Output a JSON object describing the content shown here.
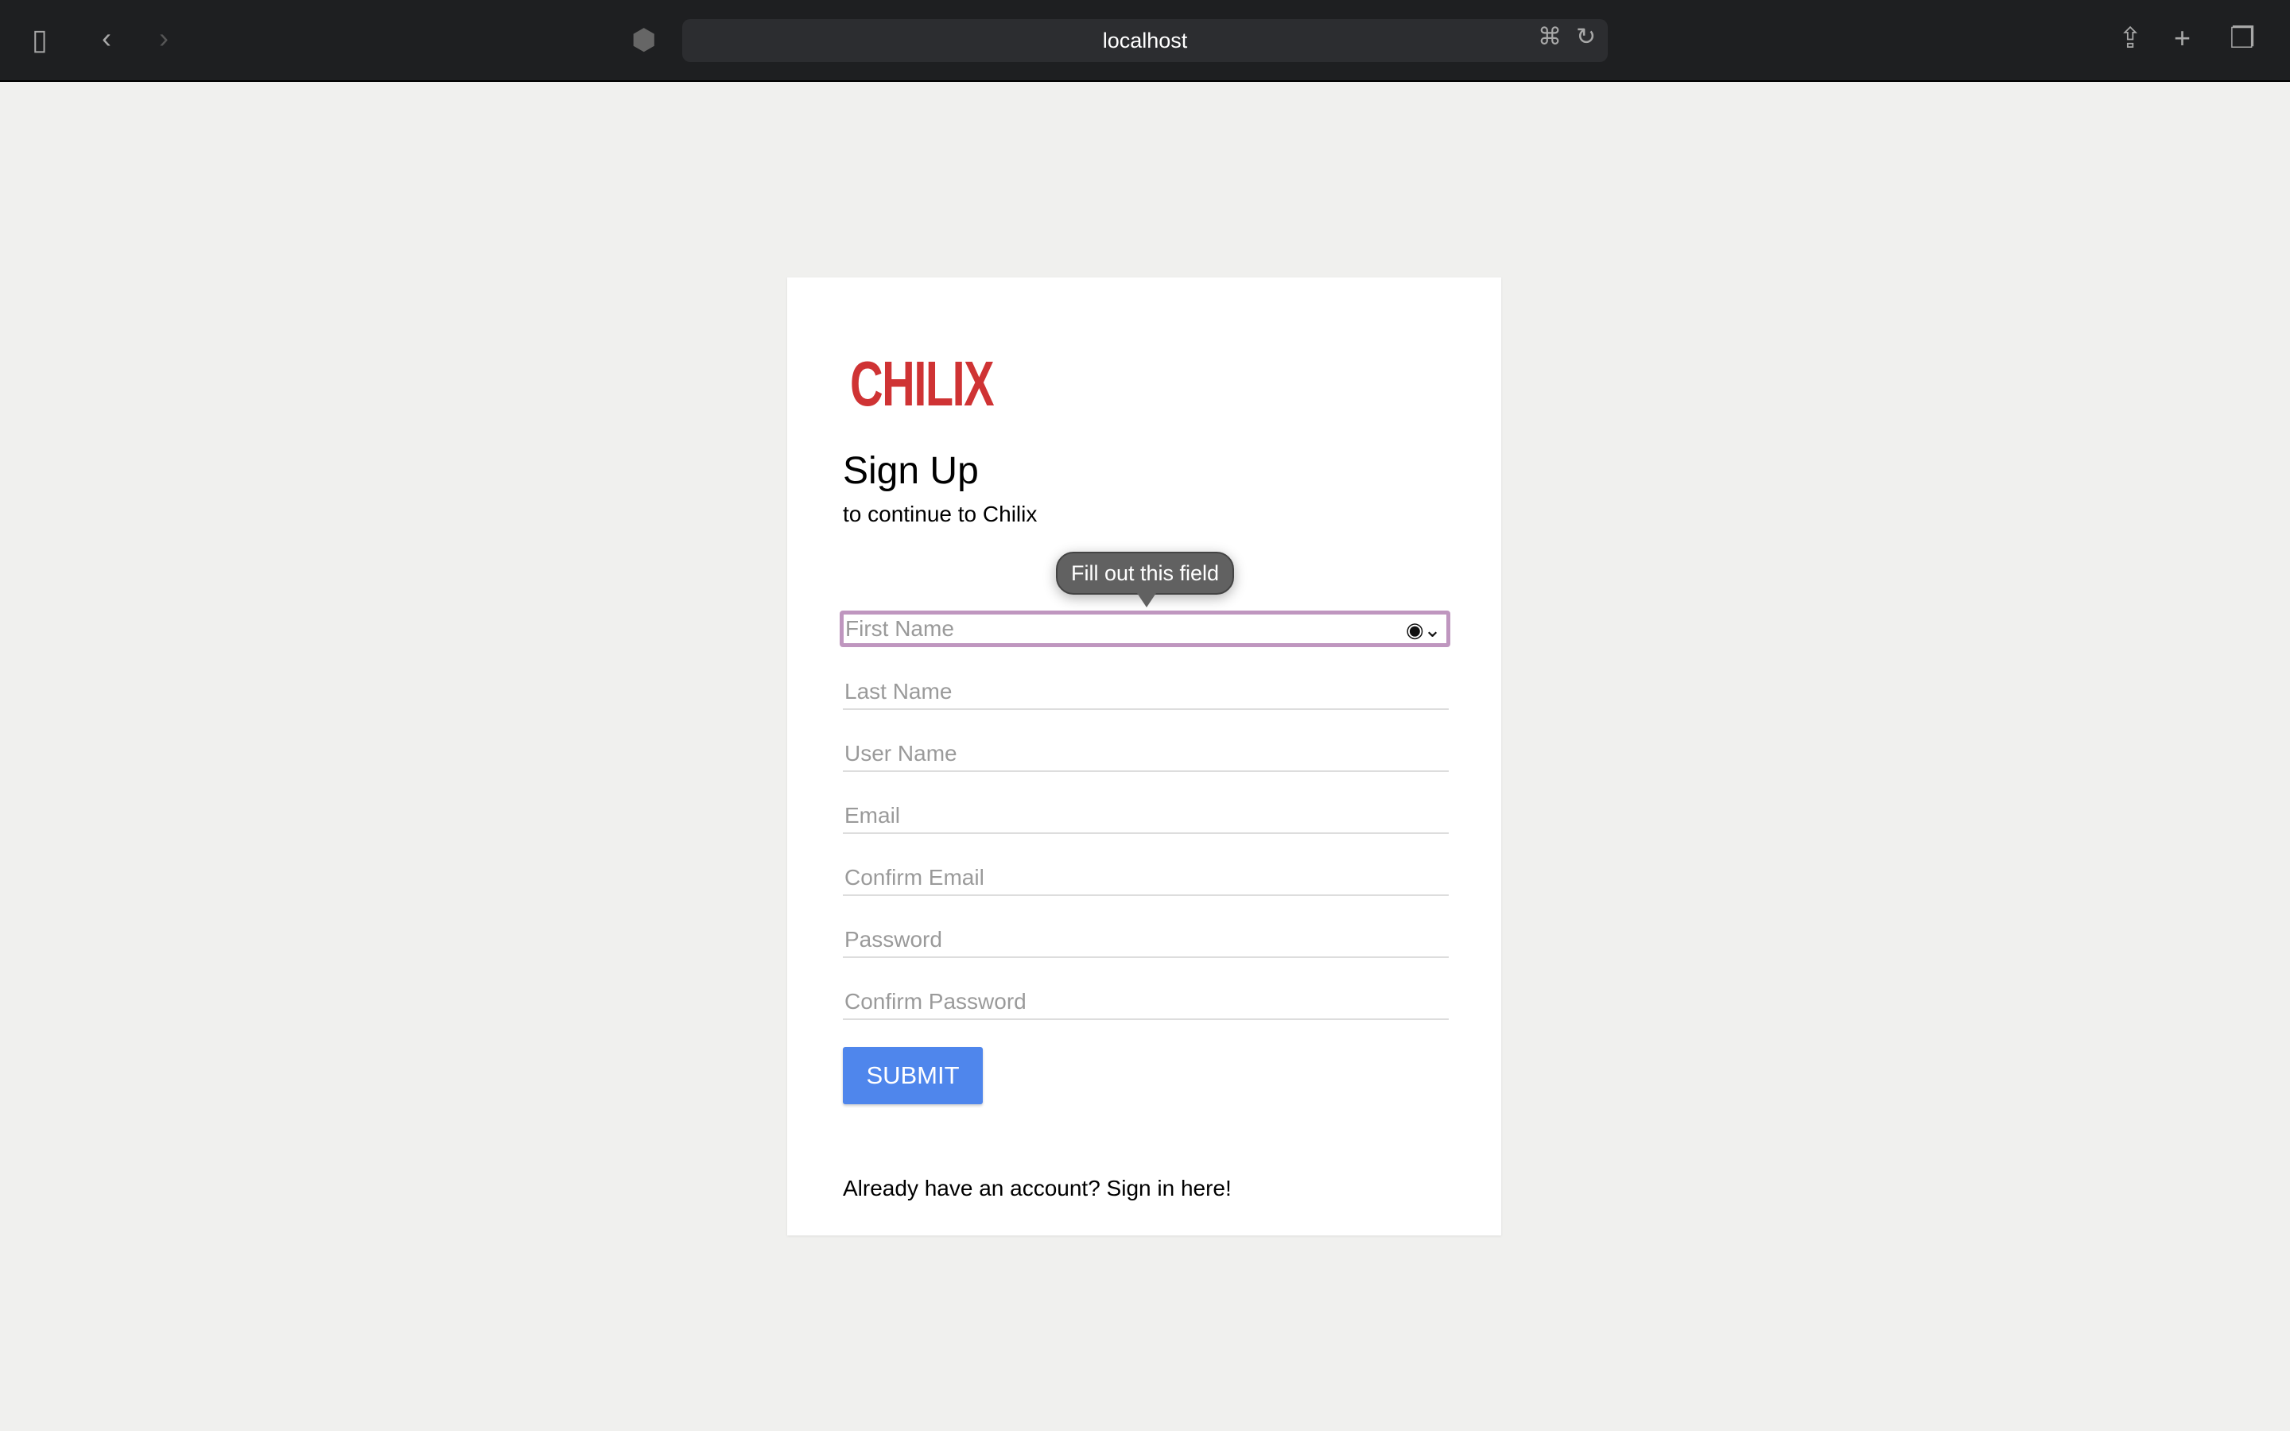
{
  "browser": {
    "url": "localhost",
    "icons": [
      "sidebar-icon",
      "back-icon",
      "forward-icon",
      "shield-icon",
      "translate-icon",
      "reload-icon",
      "share-icon",
      "new-tab-icon",
      "tabs-overview-icon"
    ]
  },
  "logo": "CHILIX",
  "form": {
    "title": "Sign Up",
    "subtitle": "to continue to Chilix",
    "tooltip": "Fill out this field",
    "fields": [
      {
        "placeholder": "First Name",
        "value": ""
      },
      {
        "placeholder": "Last Name",
        "value": ""
      },
      {
        "placeholder": "User Name",
        "value": ""
      },
      {
        "placeholder": "Email",
        "value": ""
      },
      {
        "placeholder": "Confirm Email",
        "value": ""
      },
      {
        "placeholder": "Password",
        "value": ""
      },
      {
        "placeholder": "Confirm Password",
        "value": ""
      }
    ],
    "submit_label": "SUBMIT",
    "footer": "Already have an account? Sign in here!"
  },
  "colors": {
    "brand": "#cf3334",
    "button": "#4f86ec",
    "focus": "#bf96bf"
  }
}
